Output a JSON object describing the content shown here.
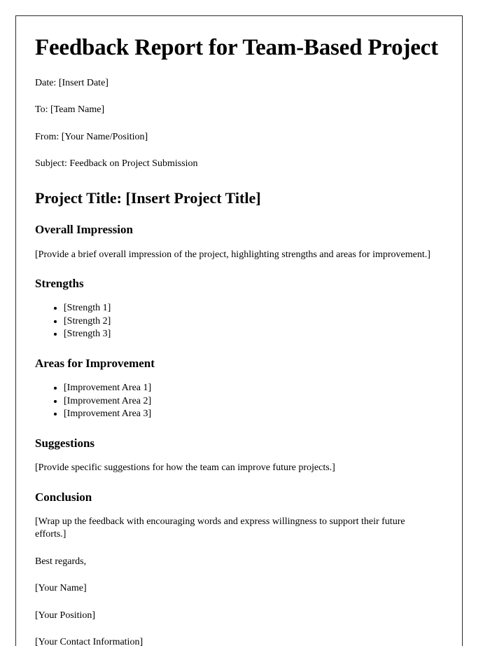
{
  "document": {
    "title": "Feedback Report for Team-Based Project",
    "header_fields": [
      {
        "label": "Date",
        "text": "Date: [Insert Date]"
      },
      {
        "label": "To",
        "text": "To: [Team Name]"
      },
      {
        "label": "From",
        "text": "From: [Your Name/Position]"
      },
      {
        "label": "Subject",
        "text": "Subject: Feedback on Project Submission"
      }
    ],
    "project_title_heading": "Project Title: [Insert Project Title]",
    "sections": {
      "overall_impression": {
        "heading": "Overall Impression",
        "body": "[Provide a brief overall impression of the project, highlighting strengths and areas for improvement.]"
      },
      "strengths": {
        "heading": "Strengths",
        "items": [
          "[Strength 1]",
          "[Strength 2]",
          "[Strength 3]"
        ]
      },
      "areas_for_improvement": {
        "heading": "Areas for Improvement",
        "items": [
          "[Improvement Area 1]",
          "[Improvement Area 2]",
          "[Improvement Area 3]"
        ]
      },
      "suggestions": {
        "heading": "Suggestions",
        "body": "[Provide specific suggestions for how the team can improve future projects.]"
      },
      "conclusion": {
        "heading": "Conclusion",
        "body": "[Wrap up the feedback with encouraging words and express willingness to support their future efforts.]"
      }
    },
    "closing": {
      "salutation": "Best regards,",
      "name": "[Your Name]",
      "position": "[Your Position]",
      "contact": "[Your Contact Information]"
    }
  }
}
